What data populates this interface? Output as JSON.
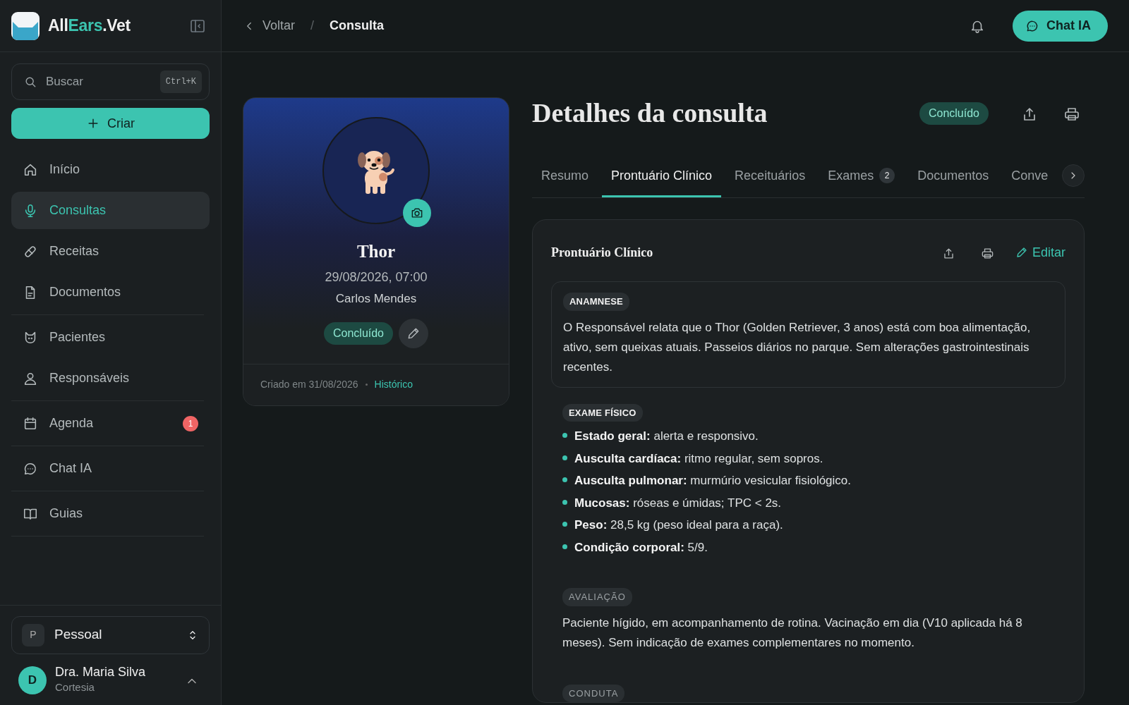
{
  "brand": {
    "prefix": "All",
    "accent": "Ears",
    "suffix": ".Vet"
  },
  "search": {
    "placeholder": "Buscar",
    "shortcut": "Ctrl+K"
  },
  "create_button": "Criar",
  "nav_groups": [
    {
      "items": [
        {
          "label": "Início",
          "selected": false
        },
        {
          "label": "Consultas",
          "selected": true
        },
        {
          "label": "Receitas",
          "selected": false
        },
        {
          "label": "Documentos",
          "selected": false
        }
      ]
    },
    {
      "items": [
        {
          "label": "Pacientes",
          "selected": false
        },
        {
          "label": "Responsáveis",
          "selected": false
        }
      ]
    },
    {
      "items": [
        {
          "label": "Agenda",
          "selected": false,
          "badge": "1"
        }
      ]
    },
    {
      "items": [
        {
          "label": "Chat IA",
          "selected": false
        }
      ]
    },
    {
      "items": [
        {
          "label": "Guias",
          "selected": false
        }
      ]
    }
  ],
  "workspace": {
    "initial": "P",
    "label": "Pessoal"
  },
  "user": {
    "initial": "D",
    "name": "Dra. Maria Silva",
    "plan": "Cortesia"
  },
  "breadcrumb": {
    "back": "Voltar",
    "separator": "/",
    "current": "Consulta"
  },
  "chat_button": "Chat IA",
  "patient": {
    "name": "Thor",
    "datetime": "29/08/2026, 07:00",
    "owner": "Carlos Mendes",
    "status": "Concluído",
    "created": "Criado em 31/08/2026",
    "history_link": "Histórico"
  },
  "details": {
    "title": "Detalhes da consulta",
    "status": "Concluído",
    "tabs": [
      {
        "label": "Resumo",
        "selected": false
      },
      {
        "label": "Prontuário Clínico",
        "selected": true
      },
      {
        "label": "Receituários",
        "selected": false
      },
      {
        "label": "Exames",
        "selected": false,
        "count": "2"
      },
      {
        "label": "Documentos",
        "selected": false
      },
      {
        "label": "Conve",
        "selected": false
      }
    ],
    "record": {
      "title": "Prontuário Clínico",
      "edit": "Editar",
      "sections": [
        {
          "kind": "paragraph",
          "label": "ANAMNESE",
          "boxed": true,
          "dimmed": false,
          "text": "O Responsável relata que o Thor (Golden Retriever, 3 anos) está com boa alimentação, ativo, sem queixas atuais. Passeios diários no parque. Sem alterações gastrointestinais recentes."
        },
        {
          "kind": "list",
          "label": "EXAME FÍSICO",
          "boxed": false,
          "dimmed": false,
          "items": [
            "**Estado geral:** alerta e responsivo.",
            "**Ausculta cardíaca:** ritmo regular, sem sopros.",
            "**Ausculta pulmonar:** murmúrio vesicular fisiológico.",
            "**Mucosas:** róseas e úmidas; TPC < 2s.",
            "**Peso:** 28,5 kg (peso ideal para a raça).",
            "**Condição corporal:** 5/9."
          ]
        },
        {
          "kind": "paragraph",
          "label": "AVALIAÇÃO",
          "boxed": false,
          "dimmed": true,
          "text": "Paciente hígido, em acompanhamento de rotina. Vacinação em dia (V10 aplicada há 8 meses). Sem indicação de exames complementares no momento."
        },
        {
          "kind": "label",
          "label": "CONDUTA",
          "boxed": false,
          "dimmed": true
        }
      ]
    }
  }
}
